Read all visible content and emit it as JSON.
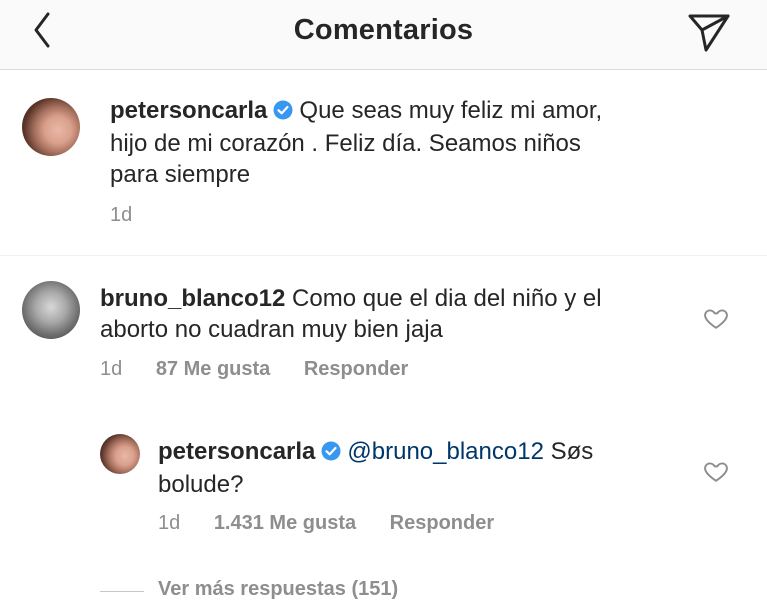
{
  "header": {
    "title": "Comentarios",
    "back_icon": "chevron-left-icon",
    "send_icon": "paper-plane-icon"
  },
  "colors": {
    "text": "#262626",
    "secondary": "#8e8e8e",
    "verified": "#3897f0",
    "mention": "#00376b",
    "header_bg": "#fafafa"
  },
  "caption": {
    "username": "petersoncarla",
    "text": "Que seas muy feliz mi amor, hijo de mi corazón .  Feliz día. Seamos niños para siempre",
    "line1_text": "Que seas muy feliz mi amor,",
    "line2": "hijo de mi corazón .  Feliz día. Seamos niños",
    "line3": "para siempre",
    "time": "1d"
  },
  "comments": [
    {
      "username": "bruno_blanco12",
      "line1_text": "Como que el dia del niño y el",
      "line2": "aborto no cuadran muy bien jaja",
      "time": "1d",
      "likes": "87 Me gusta",
      "reply_label": "Responder"
    }
  ],
  "replies": [
    {
      "username": "petersoncarla",
      "mention": "@bruno_blanco12",
      "line1_rest": " Søs",
      "line2": "bolude?",
      "time": "1d",
      "likes": "1.431 Me gusta",
      "reply_label": "Responder"
    }
  ],
  "more_replies": "Ver más respuestas (151)"
}
